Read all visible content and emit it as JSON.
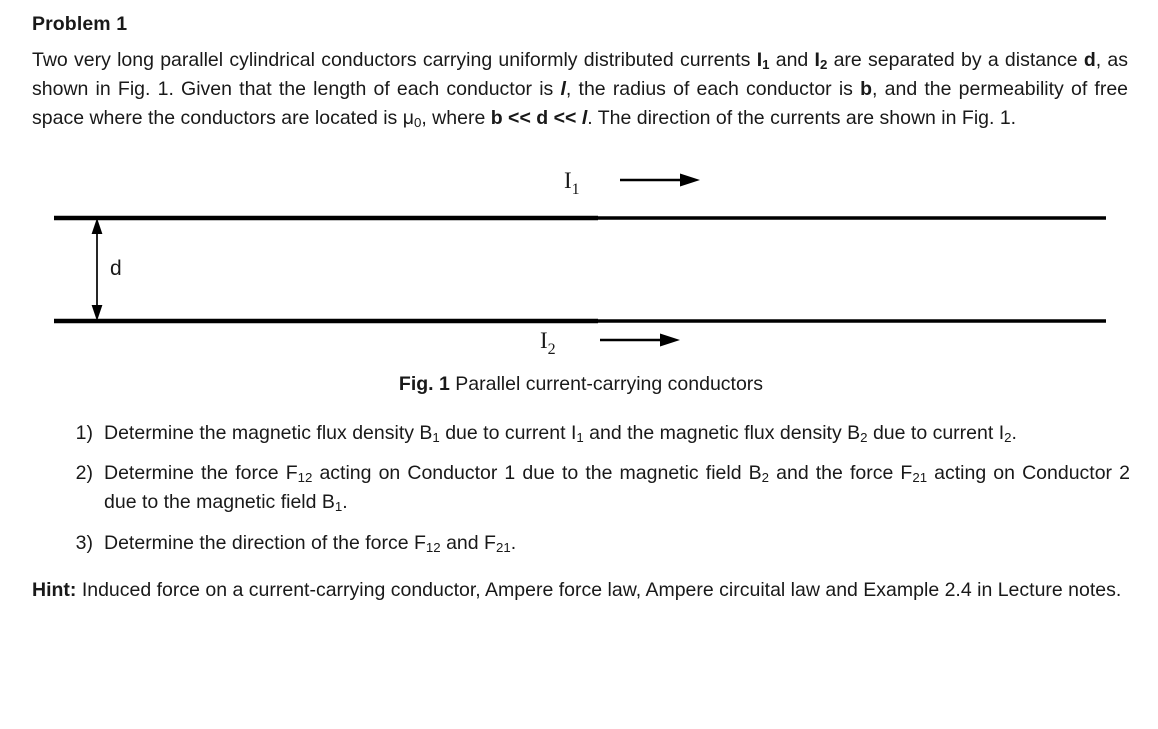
{
  "document": {
    "heading": "Problem 1",
    "intro": {
      "s1": "Two very long parallel cylindrical conductors carrying uniformly distributed currents ",
      "i1": "I",
      "i1_sub": "1",
      "s2": " and ",
      "i2": "I",
      "i2_sub": "2",
      "s3": " are separated by a distance ",
      "d": "d",
      "s4": ", as shown in Fig. 1. Given that the length of each conductor is ",
      "l": "l",
      "s5": ", the radius of each conductor is ",
      "b": "b",
      "s6": ", and the permeability of free space where the conductors are located is ",
      "mu": "μ",
      "mu_sub": "0",
      "s7": ", where ",
      "b2": "b",
      "s8": " << ",
      "d2": "d",
      "s9": " << ",
      "l2": "l",
      "s10": ". The direction of the currents are shown in Fig. 1."
    },
    "figure": {
      "label_i1": "I",
      "label_i1_sub": "1",
      "label_i2": "I",
      "label_i2_sub": "2",
      "label_d": "d",
      "line_color": "#000000",
      "caption_bold": "Fig. 1",
      "caption_rest": " Parallel current-carrying conductors"
    },
    "questions": [
      {
        "number": "1)",
        "parts": {
          "p1": "Determine the magnetic flux density B",
          "sub1": "1",
          "p2": " due to current I",
          "sub2": "1",
          "p3": " and the magnetic flux density B",
          "sub3": "2",
          "p4": " due to current I",
          "sub4": "2",
          "p5": "."
        }
      },
      {
        "number": "2)",
        "parts": {
          "p1": "Determine the force F",
          "sub1": "12",
          "p2": " acting on Conductor 1 due to the magnetic field B",
          "sub2": "2",
          "p3": " and the force F",
          "sub3": "21",
          "p4": " acting on Conductor 2 due to the magnetic field B",
          "sub4": "1",
          "p5": "."
        }
      },
      {
        "number": "3)",
        "parts": {
          "p1": "Determine the direction of the force F",
          "sub1": "12",
          "p2": " and F",
          "sub2": "21",
          "p3": ".",
          "sub3": "",
          "p4": "",
          "sub4": "",
          "p5": ""
        }
      }
    ],
    "hint": {
      "label": "Hint:",
      "text": " Induced force on a current-carrying conductor, Ampere force law, Ampere circuital law and Example 2.4 in Lecture notes."
    }
  }
}
